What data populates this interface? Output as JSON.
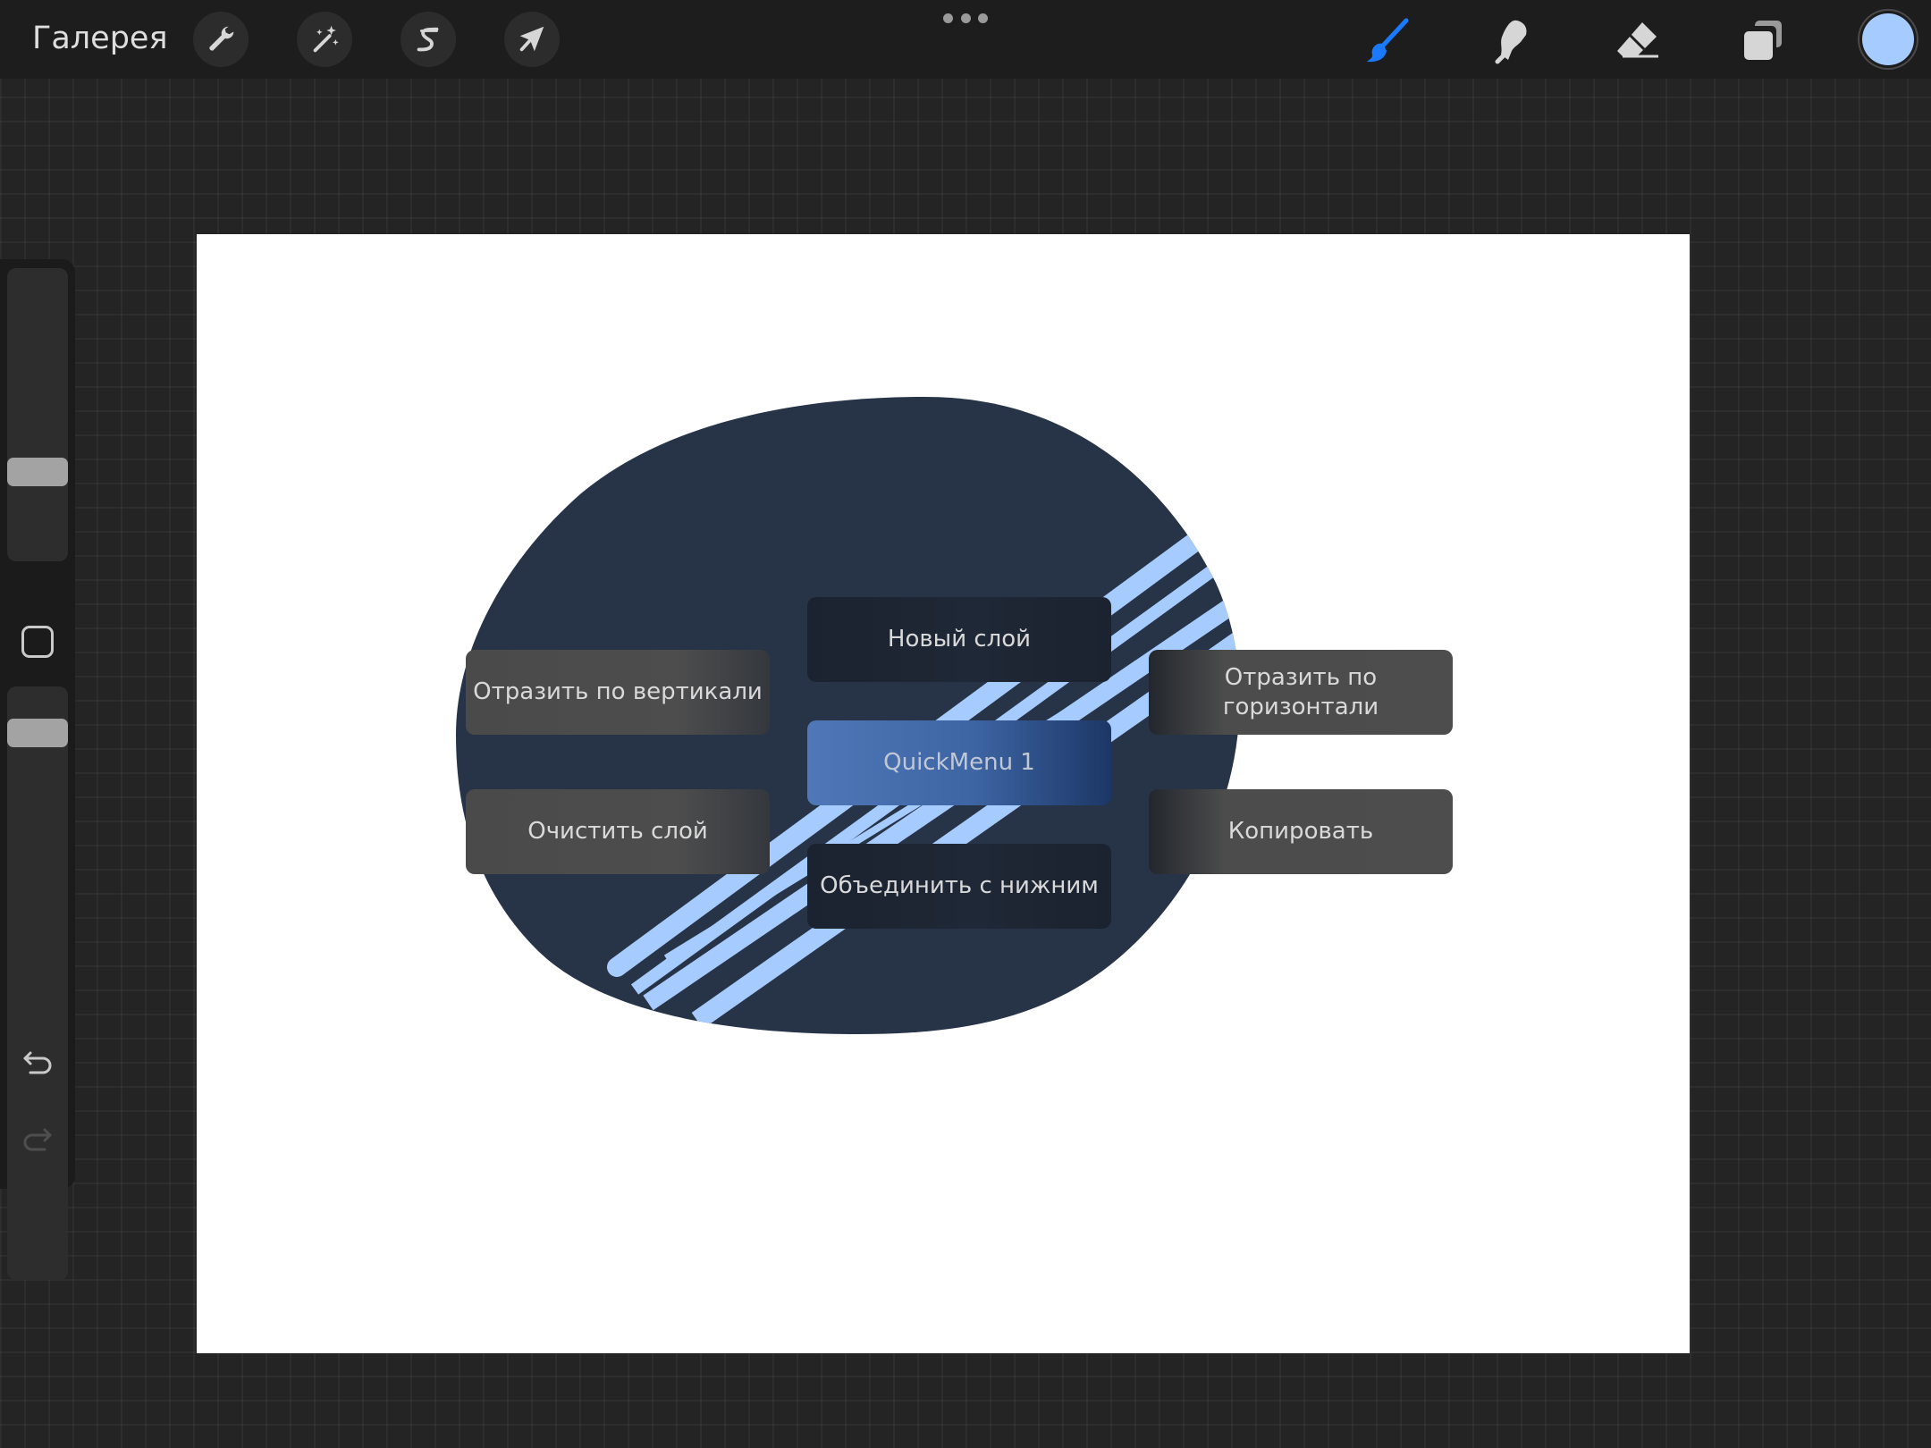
{
  "toolbar": {
    "gallery_label": "Галерея",
    "left_tools": [
      {
        "name": "actions",
        "icon": "wrench-icon"
      },
      {
        "name": "adjustments",
        "icon": "magic-wand-icon"
      },
      {
        "name": "selection",
        "icon": "selection-s-icon"
      },
      {
        "name": "transform",
        "icon": "arrow-cursor-icon"
      }
    ],
    "more_icon": "more-dots-icon",
    "right_tools": [
      {
        "name": "brush",
        "icon": "brush-icon",
        "active": true,
        "color": "#1a7aff"
      },
      {
        "name": "smudge",
        "icon": "smudge-icon"
      },
      {
        "name": "eraser",
        "icon": "eraser-icon"
      },
      {
        "name": "layers",
        "icon": "layers-icon"
      }
    ],
    "current_color": "#a6cbff"
  },
  "sidebar": {
    "brush_size_icon": "brush-size-slider",
    "opacity_icon": "opacity-slider",
    "modify_icon": "square-modify-icon",
    "undo_icon": "undo-icon",
    "redo_icon": "redo-icon"
  },
  "canvas": {
    "background": "#ffffff",
    "shape_color": "#273347",
    "stripe_color": "#a6cbff"
  },
  "quickmenu": {
    "center": "QuickMenu 1",
    "top": "Новый слой",
    "bottom": "Объединить с нижним",
    "top_left": "Отразить по вертикали",
    "bottom_left": "Очистить слой",
    "top_right_line1": "Отразить по",
    "top_right_line2": "горизонтали",
    "bottom_right": "Копировать"
  }
}
